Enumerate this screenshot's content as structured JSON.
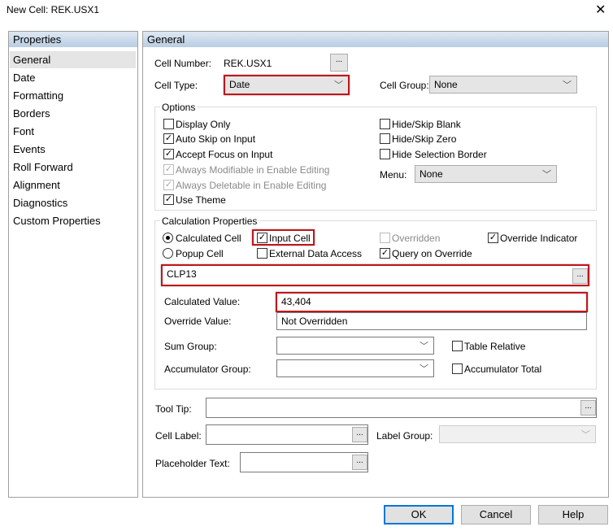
{
  "window": {
    "title": "New Cell: REK.USX1",
    "close": "✕"
  },
  "sidebar": {
    "header": "Properties",
    "items": [
      "General",
      "Date",
      "Formatting",
      "Borders",
      "Font",
      "Events",
      "Roll Forward",
      "Alignment",
      "Diagnostics",
      "Custom Properties"
    ],
    "selected": "General"
  },
  "main": {
    "header": "General",
    "cell_number_label": "Cell Number:",
    "cell_number": "REK.USX1",
    "cell_type_label": "Cell Type:",
    "cell_type": "Date",
    "cell_group_label": "Cell Group:",
    "cell_group": "None",
    "options": {
      "legend": "Options",
      "display_only": "Display Only",
      "auto_skip": "Auto Skip on Input",
      "accept_focus": "Accept Focus on Input",
      "always_modifiable": "Always Modifiable in Enable Editing",
      "always_deletable": "Always Deletable in Enable Editing",
      "use_theme": "Use Theme",
      "hide_skip_blank": "Hide/Skip Blank",
      "hide_skip_zero": "Hide/Skip Zero",
      "hide_selection_border": "Hide Selection Border",
      "menu_label": "Menu:",
      "menu": "None"
    },
    "calc": {
      "legend": "Calculation Properties",
      "calculated_cell": "Calculated Cell",
      "popup_cell": "Popup Cell",
      "input_cell": "Input Cell",
      "external_data": "External Data Access",
      "overridden": "Overridden",
      "query_on_override": "Query on Override",
      "override_indicator": "Override Indicator",
      "formula": "CLP13",
      "calculated_value_label": "Calculated Value:",
      "calculated_value": "43,404",
      "override_value_label": "Override Value:",
      "override_value": "Not Overridden",
      "sum_group_label": "Sum Group:",
      "sum_group": "",
      "table_relative": "Table Relative",
      "accumulator_group_label": "Accumulator Group:",
      "accumulator_group": "",
      "accumulator_total": "Accumulator Total"
    },
    "tool_tip_label": "Tool Tip:",
    "tool_tip": "",
    "cell_label_label": "Cell Label:",
    "cell_label": "",
    "label_group_label": "Label Group:",
    "label_group": "",
    "placeholder_label": "Placeholder Text:",
    "placeholder": ""
  },
  "buttons": {
    "ok": "OK",
    "cancel": "Cancel",
    "help": "Help"
  },
  "ellipsis": "..."
}
